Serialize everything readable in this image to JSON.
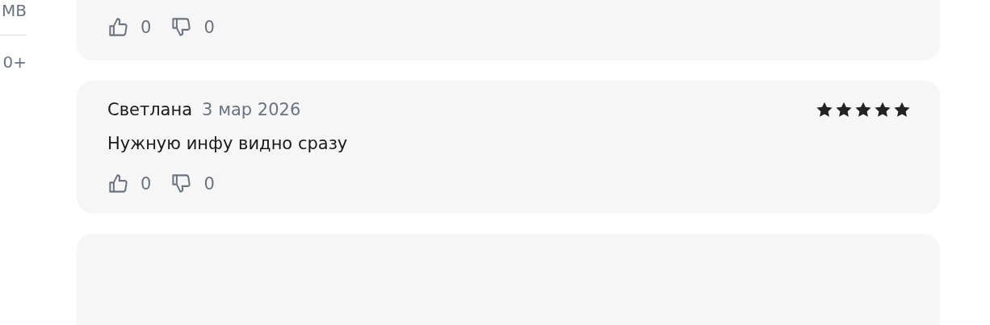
{
  "sidebar": {
    "items": [
      {
        "text": "MB"
      },
      {
        "text": "0+"
      }
    ]
  },
  "reviews": [
    {
      "kind": "tail",
      "votes": {
        "likes": "0",
        "dislikes": "0"
      }
    },
    {
      "kind": "full",
      "author": "Светлана",
      "date": "3 мар 2026",
      "stars": 5,
      "text": "Нужную инфу видно сразу",
      "votes": {
        "likes": "0",
        "dislikes": "0"
      }
    },
    {
      "kind": "top"
    }
  ]
}
